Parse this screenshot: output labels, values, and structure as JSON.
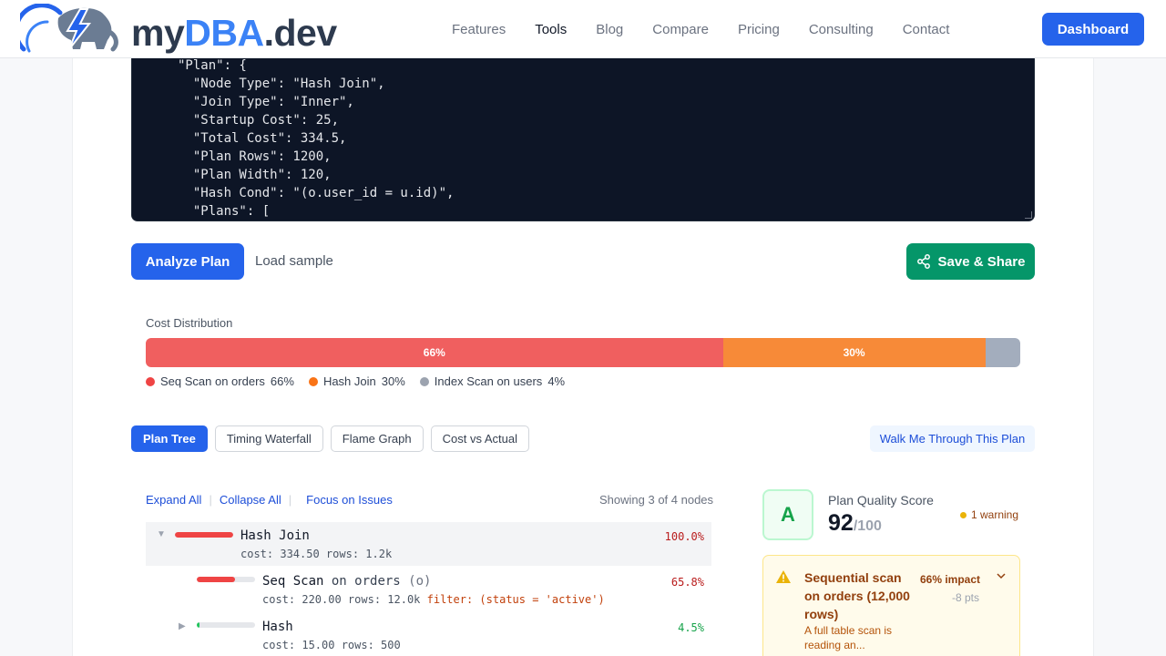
{
  "nav": {
    "logo_my": "my",
    "logo_dba": "DBA",
    "logo_dev": ".dev",
    "links": [
      "Features",
      "Tools",
      "Blog",
      "Compare",
      "Pricing",
      "Consulting",
      "Contact"
    ],
    "active_link": "Tools",
    "dashboard_label": "Dashboard"
  },
  "editor": {
    "code": "\"Plan\": {\n  \"Node Type\": \"Hash Join\",\n  \"Join Type\": \"Inner\",\n  \"Startup Cost\": 25,\n  \"Total Cost\": 334.5,\n  \"Plan Rows\": 1200,\n  \"Plan Width\": 120,\n  \"Hash Cond\": \"(o.user_id = u.id)\",\n  \"Plans\": ["
  },
  "actions": {
    "analyze_label": "Analyze Plan",
    "sample_label": "Load sample",
    "share_label": "Save & Share"
  },
  "cost_distribution": {
    "title": "Cost Distribution",
    "segments": [
      {
        "label": "66%",
        "name": "Seq Scan on orders",
        "pct_text": "66%",
        "value": 66,
        "color": "#f05f5f"
      },
      {
        "label": "30%",
        "name": "Hash Join",
        "pct_text": "30%",
        "value": 30,
        "color": "#f78a38"
      },
      {
        "label": "",
        "name": "Index Scan on users",
        "pct_text": "4%",
        "value": 4,
        "color": "#a3adbd"
      }
    ],
    "legend_colors": [
      "#ef4444",
      "#f97316",
      "#9ca3af"
    ]
  },
  "tabs": {
    "items": [
      "Plan Tree",
      "Timing Waterfall",
      "Flame Graph",
      "Cost vs Actual"
    ],
    "active": "Plan Tree",
    "walk_label": "Walk Me Through This Plan"
  },
  "tree": {
    "expand_all": "Expand All",
    "collapse_all": "Collapse All",
    "focus_issues": "Focus on Issues",
    "showing": "Showing 3 of 4 nodes",
    "nodes": [
      {
        "name": "Hash Join",
        "meta": "cost: 334.50  rows: 1.2k",
        "pct": "100.0%",
        "cost_fraction": 1.0,
        "bar_color": "#ef4444",
        "pct_color": "#b91c1c"
      },
      {
        "name": "Seq Scan",
        "relation": "on orders",
        "alias": "(o)",
        "meta": "cost: 220.00  rows: 12.0k",
        "filter": "filter: (status = 'active')",
        "pct": "65.8%",
        "cost_fraction": 0.658,
        "bar_color": "#ef4444",
        "pct_color": "#b91c1c"
      },
      {
        "name": "Hash",
        "meta": "cost: 15.00  rows: 500",
        "pct": "4.5%",
        "cost_fraction": 0.045,
        "bar_color": "#22c55e",
        "pct_color": "#16a34a"
      }
    ]
  },
  "score": {
    "grade": "A",
    "title": "Plan Quality Score",
    "value": "92",
    "max": "/100",
    "warning": "1 warning"
  },
  "issue": {
    "title": "Sequential scan on orders (12,000 rows)",
    "desc": "A full table scan is reading an...",
    "impact": "66% impact",
    "pts": "-8 pts"
  }
}
